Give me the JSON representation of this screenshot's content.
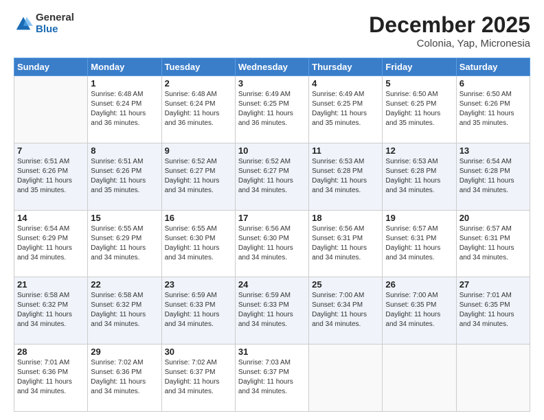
{
  "header": {
    "logo": {
      "general": "General",
      "blue": "Blue"
    },
    "title": "December 2025",
    "subtitle": "Colonia, Yap, Micronesia"
  },
  "calendar": {
    "days_of_week": [
      "Sunday",
      "Monday",
      "Tuesday",
      "Wednesday",
      "Thursday",
      "Friday",
      "Saturday"
    ],
    "weeks": [
      [
        {
          "date": "",
          "empty": true
        },
        {
          "date": "1",
          "sunrise": "6:48 AM",
          "sunset": "6:24 PM",
          "daylight": "11 hours and 36 minutes."
        },
        {
          "date": "2",
          "sunrise": "6:48 AM",
          "sunset": "6:24 PM",
          "daylight": "11 hours and 36 minutes."
        },
        {
          "date": "3",
          "sunrise": "6:49 AM",
          "sunset": "6:25 PM",
          "daylight": "11 hours and 36 minutes."
        },
        {
          "date": "4",
          "sunrise": "6:49 AM",
          "sunset": "6:25 PM",
          "daylight": "11 hours and 35 minutes."
        },
        {
          "date": "5",
          "sunrise": "6:50 AM",
          "sunset": "6:25 PM",
          "daylight": "11 hours and 35 minutes."
        },
        {
          "date": "6",
          "sunrise": "6:50 AM",
          "sunset": "6:26 PM",
          "daylight": "11 hours and 35 minutes."
        }
      ],
      [
        {
          "date": "7",
          "sunrise": "6:51 AM",
          "sunset": "6:26 PM",
          "daylight": "11 hours and 35 minutes."
        },
        {
          "date": "8",
          "sunrise": "6:51 AM",
          "sunset": "6:26 PM",
          "daylight": "11 hours and 35 minutes."
        },
        {
          "date": "9",
          "sunrise": "6:52 AM",
          "sunset": "6:27 PM",
          "daylight": "11 hours and 34 minutes."
        },
        {
          "date": "10",
          "sunrise": "6:52 AM",
          "sunset": "6:27 PM",
          "daylight": "11 hours and 34 minutes."
        },
        {
          "date": "11",
          "sunrise": "6:53 AM",
          "sunset": "6:28 PM",
          "daylight": "11 hours and 34 minutes."
        },
        {
          "date": "12",
          "sunrise": "6:53 AM",
          "sunset": "6:28 PM",
          "daylight": "11 hours and 34 minutes."
        },
        {
          "date": "13",
          "sunrise": "6:54 AM",
          "sunset": "6:28 PM",
          "daylight": "11 hours and 34 minutes."
        }
      ],
      [
        {
          "date": "14",
          "sunrise": "6:54 AM",
          "sunset": "6:29 PM",
          "daylight": "11 hours and 34 minutes."
        },
        {
          "date": "15",
          "sunrise": "6:55 AM",
          "sunset": "6:29 PM",
          "daylight": "11 hours and 34 minutes."
        },
        {
          "date": "16",
          "sunrise": "6:55 AM",
          "sunset": "6:30 PM",
          "daylight": "11 hours and 34 minutes."
        },
        {
          "date": "17",
          "sunrise": "6:56 AM",
          "sunset": "6:30 PM",
          "daylight": "11 hours and 34 minutes."
        },
        {
          "date": "18",
          "sunrise": "6:56 AM",
          "sunset": "6:31 PM",
          "daylight": "11 hours and 34 minutes."
        },
        {
          "date": "19",
          "sunrise": "6:57 AM",
          "sunset": "6:31 PM",
          "daylight": "11 hours and 34 minutes."
        },
        {
          "date": "20",
          "sunrise": "6:57 AM",
          "sunset": "6:31 PM",
          "daylight": "11 hours and 34 minutes."
        }
      ],
      [
        {
          "date": "21",
          "sunrise": "6:58 AM",
          "sunset": "6:32 PM",
          "daylight": "11 hours and 34 minutes."
        },
        {
          "date": "22",
          "sunrise": "6:58 AM",
          "sunset": "6:32 PM",
          "daylight": "11 hours and 34 minutes."
        },
        {
          "date": "23",
          "sunrise": "6:59 AM",
          "sunset": "6:33 PM",
          "daylight": "11 hours and 34 minutes."
        },
        {
          "date": "24",
          "sunrise": "6:59 AM",
          "sunset": "6:33 PM",
          "daylight": "11 hours and 34 minutes."
        },
        {
          "date": "25",
          "sunrise": "7:00 AM",
          "sunset": "6:34 PM",
          "daylight": "11 hours and 34 minutes."
        },
        {
          "date": "26",
          "sunrise": "7:00 AM",
          "sunset": "6:35 PM",
          "daylight": "11 hours and 34 minutes."
        },
        {
          "date": "27",
          "sunrise": "7:01 AM",
          "sunset": "6:35 PM",
          "daylight": "11 hours and 34 minutes."
        }
      ],
      [
        {
          "date": "28",
          "sunrise": "7:01 AM",
          "sunset": "6:36 PM",
          "daylight": "11 hours and 34 minutes."
        },
        {
          "date": "29",
          "sunrise": "7:02 AM",
          "sunset": "6:36 PM",
          "daylight": "11 hours and 34 minutes."
        },
        {
          "date": "30",
          "sunrise": "7:02 AM",
          "sunset": "6:37 PM",
          "daylight": "11 hours and 34 minutes."
        },
        {
          "date": "31",
          "sunrise": "7:03 AM",
          "sunset": "6:37 PM",
          "daylight": "11 hours and 34 minutes."
        },
        {
          "date": "",
          "empty": true
        },
        {
          "date": "",
          "empty": true
        },
        {
          "date": "",
          "empty": true
        }
      ]
    ]
  }
}
